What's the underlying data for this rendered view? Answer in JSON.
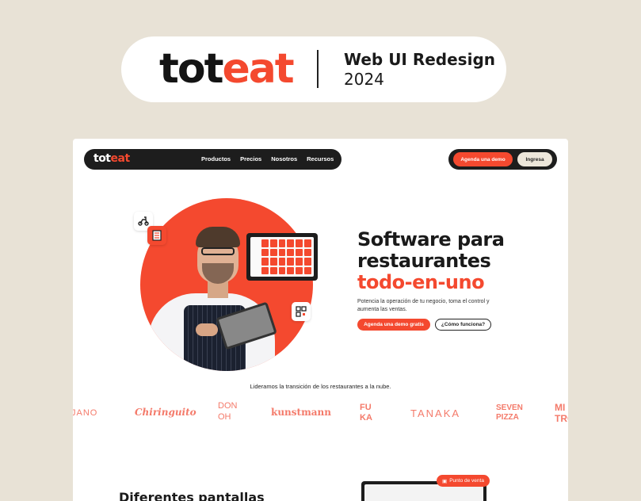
{
  "cover": {
    "brand_part1": "tot",
    "brand_part2": "eat",
    "title": "Web UI Redesign",
    "year": "2024"
  },
  "nav": {
    "logo_part1": "tot",
    "logo_part2": "eat",
    "links": [
      "Productos",
      "Precios",
      "Nosotros",
      "Recursos"
    ],
    "demo_button": "Agenda una demo",
    "login_button": "Ingresa"
  },
  "hero": {
    "title_line1": "Software para",
    "title_line2": "restaurantes",
    "title_accent": "todo-en-uno",
    "subtitle": "Potencia la operación de tu negocio, toma el control y aumenta las ventas.",
    "primary_button": "Agenda una demo gratis",
    "secondary_button": "¿Cómo funciona?"
  },
  "clients": {
    "tagline": "Lideramos la transición de los restaurantes a la nube.",
    "logos": [
      "JANO",
      "Chiringuito",
      "DON OH",
      "kunstmann",
      "FU KA",
      "TANAKA",
      "SEVEN PIZZA",
      "MI TRO"
    ]
  },
  "next_section": {
    "title": "Diferentes pantallas",
    "badge": "Punto de venta"
  },
  "colors": {
    "accent": "#f4492f",
    "dark": "#1d1d1d",
    "background": "#e8e2d6"
  }
}
